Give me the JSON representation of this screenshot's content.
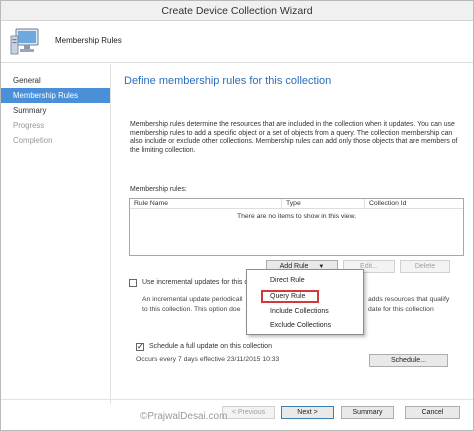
{
  "window": {
    "title": "Create Device Collection Wizard"
  },
  "header": {
    "title": "Membership Rules",
    "icon": "computer-icon"
  },
  "nav": {
    "items": [
      {
        "label": "General",
        "state": "normal"
      },
      {
        "label": "Membership Rules",
        "state": "active"
      },
      {
        "label": "Summary",
        "state": "normal"
      },
      {
        "label": "Progress",
        "state": "disabled"
      },
      {
        "label": "Completion",
        "state": "normal"
      }
    ]
  },
  "main": {
    "section_title": "Define membership rules for this collection",
    "description": "Membership rules determine the resources that are included in the collection when it updates. You can use membership rules to add a specific object or a set of objects from a query. The collection membership can also include or exclude other collections. Membership rules can add only those objects that are members of the limiting collection.",
    "rules_label": "Membership rules:",
    "columns": [
      "Rule Name",
      "Type",
      "Collection Id"
    ],
    "empty_message": "There are no items to show in this view.",
    "add_rule_label": "Add Rule",
    "edit_label": "Edit...",
    "delete_label": "Delete",
    "incremental": {
      "label": "Use incremental updates for this c",
      "checked": false,
      "info_line1_a": "An incremental update periodicall",
      "info_line1_b": "adds resources that qualify",
      "info_line2_a": "to this collection. This option doe",
      "info_line2_b": "date for this collection"
    },
    "schedule": {
      "label": "Schedule a full update on this collection",
      "checked": true,
      "occurs": "Occurs every 7 days effective 23/11/2015 10:33",
      "button_label": "Schedule..."
    }
  },
  "add_rule_menu": {
    "items": [
      "Direct Rule",
      "Query Rule",
      "Include Collections",
      "Exclude Collections"
    ],
    "highlighted": "Query Rule",
    "highlight_color": "#d03a3a"
  },
  "footer": {
    "previous_label": "< Previous",
    "next_label": "Next >",
    "summary_label": "Summary",
    "cancel_label": "Cancel"
  },
  "watermark": "©PrajwalDesai.com",
  "colors": {
    "accent": "#2a6ebb",
    "nav_active": "#4a90d9"
  }
}
